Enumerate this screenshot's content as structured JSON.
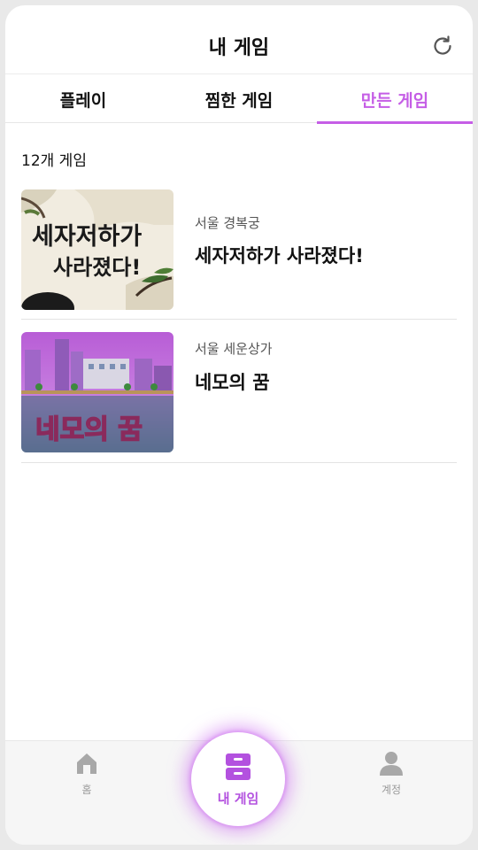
{
  "header": {
    "title": "내 게임",
    "refresh_icon": "refresh-icon"
  },
  "tabs": [
    {
      "label": "플레이"
    },
    {
      "label": "찜한 게임"
    },
    {
      "label": "만든 게임"
    }
  ],
  "active_tab": "만든 게임",
  "count_text": "12개 게임",
  "games": [
    {
      "location": "서울 경복궁",
      "title": "세자저하가 사라졌다!",
      "thumb_text_1": "세자저하가",
      "thumb_text_2": "사라졌다!"
    },
    {
      "location": "서울 세운상가",
      "title": "네모의 꿈",
      "thumb_text": "네모의 꿈"
    }
  ],
  "nav": {
    "home_label": "홈",
    "my_games_label": "내 게임",
    "account_label": "계정"
  },
  "colors": {
    "accent": "#c55ee6",
    "text": "#111111",
    "nav_inactive": "#9a9a9a"
  }
}
